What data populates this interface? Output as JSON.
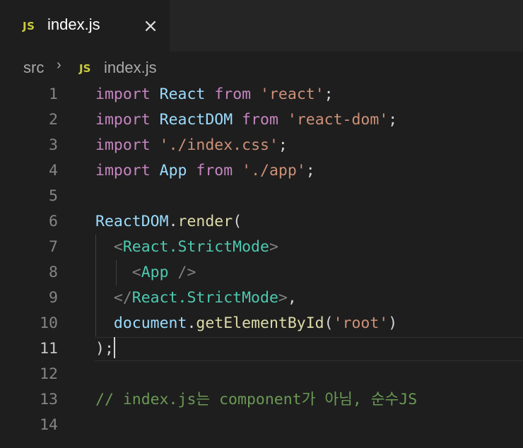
{
  "tab": {
    "icon": "JS",
    "filename": "index.js",
    "close": "×"
  },
  "breadcrumb": {
    "folder": "src",
    "separator": "›",
    "icon": "JS",
    "file": "index.js"
  },
  "editor": {
    "active_line": 11,
    "lines": [
      {
        "n": "1",
        "t": [
          {
            "c": "kw",
            "s": "import"
          },
          {
            "c": "pn",
            "s": " "
          },
          {
            "c": "var",
            "s": "React"
          },
          {
            "c": "pn",
            "s": " "
          },
          {
            "c": "kw",
            "s": "from"
          },
          {
            "c": "pn",
            "s": " "
          },
          {
            "c": "str",
            "s": "'react'"
          },
          {
            "c": "pn",
            "s": ";"
          }
        ]
      },
      {
        "n": "2",
        "t": [
          {
            "c": "kw",
            "s": "import"
          },
          {
            "c": "pn",
            "s": " "
          },
          {
            "c": "var",
            "s": "ReactDOM"
          },
          {
            "c": "pn",
            "s": " "
          },
          {
            "c": "kw",
            "s": "from"
          },
          {
            "c": "pn",
            "s": " "
          },
          {
            "c": "str",
            "s": "'react-dom'"
          },
          {
            "c": "pn",
            "s": ";"
          }
        ]
      },
      {
        "n": "3",
        "t": [
          {
            "c": "kw",
            "s": "import"
          },
          {
            "c": "pn",
            "s": " "
          },
          {
            "c": "str",
            "s": "'./index.css'"
          },
          {
            "c": "pn",
            "s": ";"
          }
        ]
      },
      {
        "n": "4",
        "t": [
          {
            "c": "kw",
            "s": "import"
          },
          {
            "c": "pn",
            "s": " "
          },
          {
            "c": "var",
            "s": "App"
          },
          {
            "c": "pn",
            "s": " "
          },
          {
            "c": "kw",
            "s": "from"
          },
          {
            "c": "pn",
            "s": " "
          },
          {
            "c": "str",
            "s": "'./app'"
          },
          {
            "c": "pn",
            "s": ";"
          }
        ]
      },
      {
        "n": "5",
        "t": []
      },
      {
        "n": "6",
        "t": [
          {
            "c": "var",
            "s": "ReactDOM"
          },
          {
            "c": "pn",
            "s": "."
          },
          {
            "c": "fn",
            "s": "render"
          },
          {
            "c": "pn",
            "s": "("
          }
        ]
      },
      {
        "n": "7",
        "t": [
          {
            "c": "pn",
            "s": "  "
          },
          {
            "c": "br",
            "s": "<"
          },
          {
            "c": "tag",
            "s": "React.StrictMode"
          },
          {
            "c": "br",
            "s": ">"
          }
        ]
      },
      {
        "n": "8",
        "t": [
          {
            "c": "pn",
            "s": "    "
          },
          {
            "c": "br",
            "s": "<"
          },
          {
            "c": "tag",
            "s": "App"
          },
          {
            "c": "pn",
            "s": " "
          },
          {
            "c": "br",
            "s": "/>"
          }
        ]
      },
      {
        "n": "9",
        "t": [
          {
            "c": "pn",
            "s": "  "
          },
          {
            "c": "br",
            "s": "</"
          },
          {
            "c": "tag",
            "s": "React.StrictMode"
          },
          {
            "c": "br",
            "s": ">"
          },
          {
            "c": "pn",
            "s": ","
          }
        ]
      },
      {
        "n": "10",
        "t": [
          {
            "c": "pn",
            "s": "  "
          },
          {
            "c": "var",
            "s": "document"
          },
          {
            "c": "pn",
            "s": "."
          },
          {
            "c": "fn",
            "s": "getElementById"
          },
          {
            "c": "pn",
            "s": "("
          },
          {
            "c": "str",
            "s": "'root'"
          },
          {
            "c": "pn",
            "s": ")"
          }
        ]
      },
      {
        "n": "11",
        "t": [
          {
            "c": "pn",
            "s": ");"
          }
        ]
      },
      {
        "n": "12",
        "t": []
      },
      {
        "n": "13",
        "t": [
          {
            "c": "cm",
            "s": "// index.js는 component가 아님, 순수JS"
          }
        ]
      },
      {
        "n": "14",
        "t": []
      }
    ]
  }
}
